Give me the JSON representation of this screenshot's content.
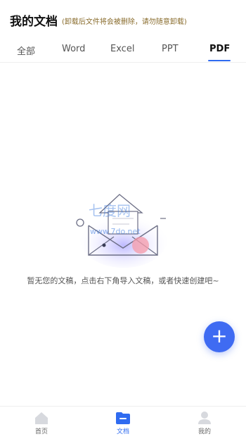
{
  "header": {
    "title": "我的文档",
    "subtitle": "(卸载后文件将会被删除，请勿随意卸载)"
  },
  "tabs": [
    {
      "label": "全部",
      "active": false
    },
    {
      "label": "Word",
      "active": false
    },
    {
      "label": "Excel",
      "active": false
    },
    {
      "label": "PPT",
      "active": false
    },
    {
      "label": "PDF",
      "active": true
    }
  ],
  "empty_state": {
    "message": "暂无您的文稿，点击右下角导入文稿，或者快速创建吧~",
    "illustration_icon": "envelope-empty-icon",
    "watermark": "七度网 www.7do.net"
  },
  "fab": {
    "label": "+",
    "icon": "plus-icon"
  },
  "bottom_nav": [
    {
      "label": "首页",
      "icon": "home-icon",
      "active": false
    },
    {
      "label": "文档",
      "icon": "folder-icon",
      "active": true
    },
    {
      "label": "我的",
      "icon": "user-icon",
      "active": false
    }
  ],
  "colors": {
    "accent": "#2f6bf0",
    "fab": "#3f6bf2",
    "subtitle": "#8a6d2e"
  }
}
